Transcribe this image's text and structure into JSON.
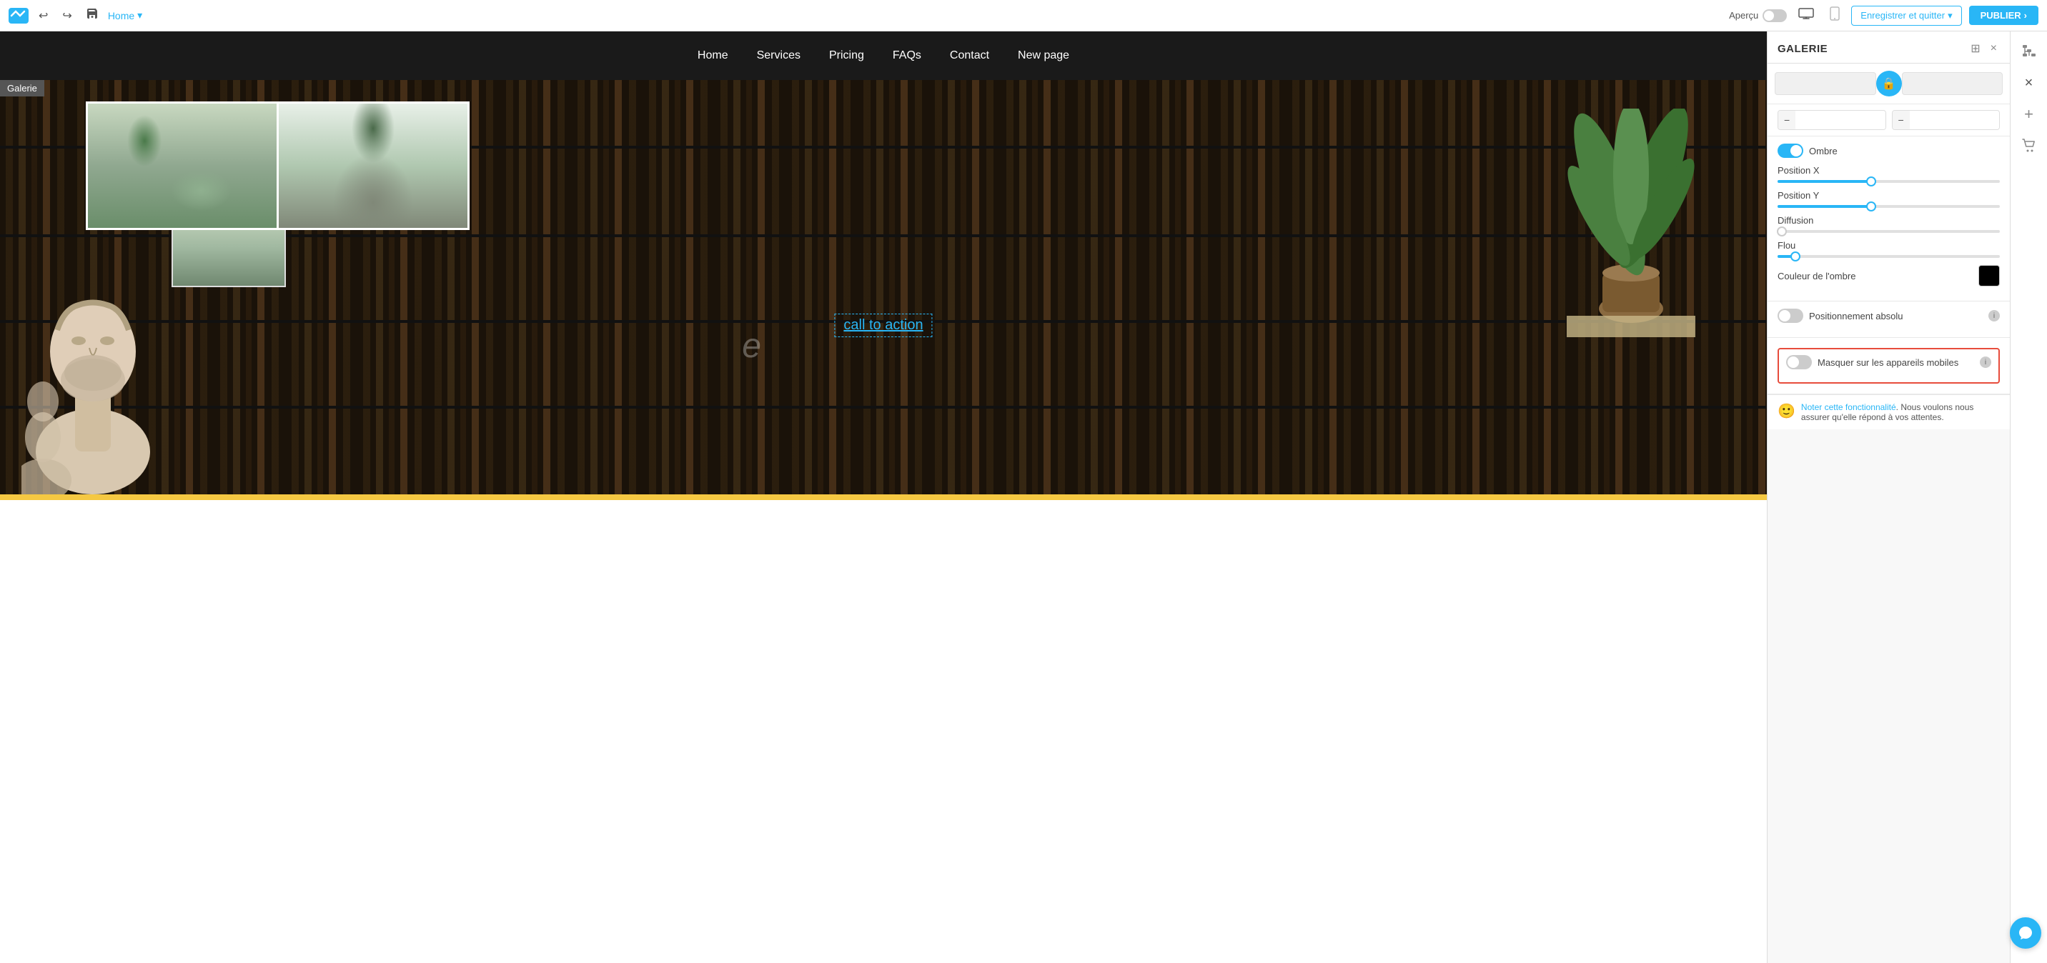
{
  "toolbar": {
    "home_label": "Home",
    "undo_title": "Undo",
    "redo_title": "Redo",
    "save_title": "Save",
    "preview_label": "Aperçu",
    "save_quit_label": "Enregistrer et quitter",
    "publish_label": "PUBLIER",
    "chevron": "▾",
    "arrow": "›"
  },
  "site_nav": {
    "items": [
      {
        "label": "Home"
      },
      {
        "label": "Services"
      },
      {
        "label": "Pricing"
      },
      {
        "label": "FAQs"
      },
      {
        "label": "Contact"
      },
      {
        "label": "New page"
      }
    ]
  },
  "canvas": {
    "galerie_label": "Galerie",
    "cta_text": "call to action"
  },
  "panel": {
    "title": "GALERIE",
    "close_icon": "×",
    "pin_icon": "⊞",
    "width_placeholder": "",
    "height_placeholder": "",
    "shadow_label": "Ombre",
    "position_x_label": "Position X",
    "position_y_label": "Position Y",
    "diffusion_label": "Diffusion",
    "blur_label": "Flou",
    "color_label": "Couleur de l'ombre",
    "absolute_pos_label": "Positionnement absolu",
    "hide_mobile_label": "Masquer sur les appareils mobiles",
    "slider_x_fill": 42,
    "slider_y_fill": 42,
    "slider_diff_fill": 0,
    "slider_blur_fill": 8,
    "feedback_link": "Noter cette fonctionnalité",
    "feedback_text": ". Nous voulons nous assurer qu'elle répond à vos attentes.",
    "shadow_on": true,
    "absolute_pos_on": false,
    "hide_mobile_on": false
  },
  "far_sidebar": {
    "sitemap_icon": "⬡",
    "close_icon": "×",
    "add_icon": "+",
    "cart_icon": "🛒"
  }
}
